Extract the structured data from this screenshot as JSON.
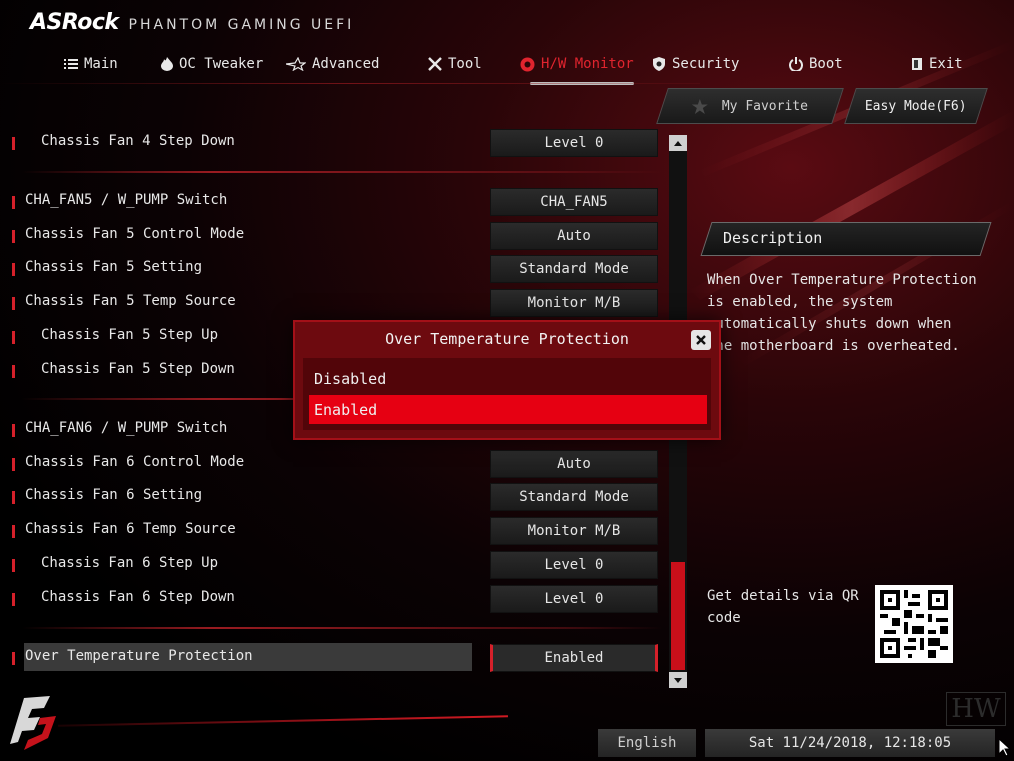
{
  "header": {
    "brand": "ASRock",
    "subtitle": "PHANTOM GAMING UEFI"
  },
  "nav": {
    "tabs": [
      {
        "label": "Main",
        "icon": "list-icon",
        "active": false
      },
      {
        "label": "OC Tweaker",
        "icon": "flame-icon",
        "active": false
      },
      {
        "label": "Advanced",
        "icon": "star-icon",
        "active": false
      },
      {
        "label": "Tool",
        "icon": "tools-icon",
        "active": false
      },
      {
        "label": "H/W Monitor",
        "icon": "monitor-icon",
        "active": true
      },
      {
        "label": "Security",
        "icon": "shield-icon",
        "active": false
      },
      {
        "label": "Boot",
        "icon": "power-icon",
        "active": false
      },
      {
        "label": "Exit",
        "icon": "exit-icon",
        "active": false
      }
    ]
  },
  "toolbar": {
    "favorite_label": "My Favorite",
    "easy_mode_label": "Easy Mode(F6)"
  },
  "settings": [
    {
      "label": "Chassis Fan 4 Step Down",
      "value": "Level 0"
    },
    {
      "label": "CHA_FAN5 / W_PUMP Switch",
      "value": "CHA_FAN5"
    },
    {
      "label": "Chassis Fan 5 Control Mode",
      "value": "Auto"
    },
    {
      "label": "Chassis Fan 5 Setting",
      "value": "Standard Mode"
    },
    {
      "label": "Chassis Fan 5 Temp Source",
      "value": "Monitor M/B"
    },
    {
      "label": "Chassis Fan 5 Step Up",
      "value": ""
    },
    {
      "label": "Chassis Fan 5 Step Down",
      "value": ""
    },
    {
      "label": "CHA_FAN6 / W_PUMP Switch",
      "value": ""
    },
    {
      "label": "Chassis Fan 6 Control Mode",
      "value": "Auto"
    },
    {
      "label": "Chassis Fan 6 Setting",
      "value": "Standard Mode"
    },
    {
      "label": "Chassis Fan 6 Temp Source",
      "value": "Monitor M/B"
    },
    {
      "label": "Chassis Fan 6 Step Up",
      "value": "Level 0"
    },
    {
      "label": "Chassis Fan 6 Step Down",
      "value": "Level 0"
    },
    {
      "label": "Over Temperature Protection",
      "value": "Enabled"
    }
  ],
  "description": {
    "title": "Description",
    "text": "When Over Temperature Protection is enabled, the system automatically shuts down when the motherboard is overheated."
  },
  "qr": {
    "text": "Get details via QR code"
  },
  "modal": {
    "title": "Over Temperature Protection",
    "options": [
      "Disabled",
      "Enabled"
    ],
    "selected": "Enabled"
  },
  "footer": {
    "language": "English",
    "datetime": "Sat 11/24/2018, 12:18:05",
    "watermark": "HW"
  },
  "colors": {
    "accent": "#e60012",
    "active_tab": "#e0242e",
    "panel": "#1f1f1f"
  }
}
